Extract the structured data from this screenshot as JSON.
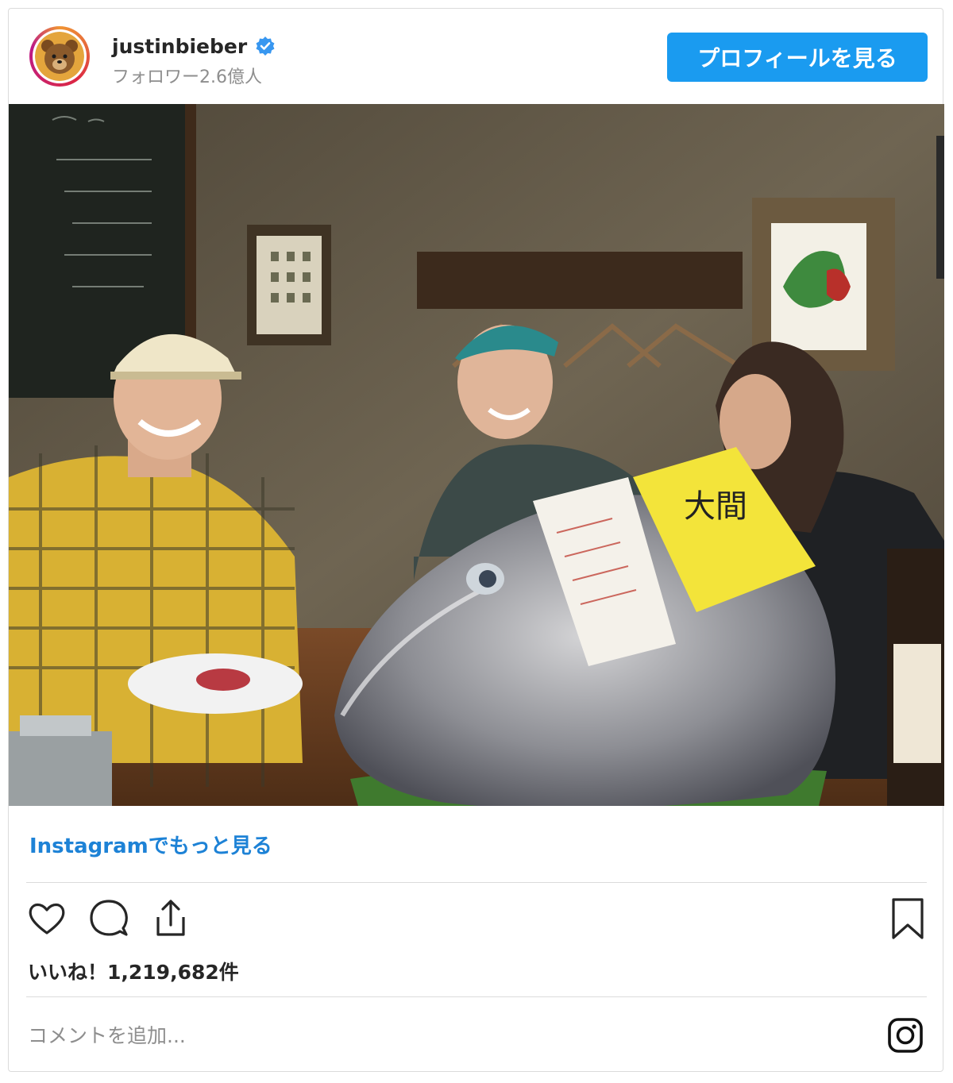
{
  "header": {
    "username": "justinbieber",
    "followers": "フォロワー2.6億人",
    "profile_button": "プロフィールを見る"
  },
  "post": {
    "image_alt": "Instagram post photo",
    "tuna_label_text": "大間",
    "view_more_link": "Instagramでもっと見る",
    "likes": "いいね！1,219,682件",
    "comment_placeholder": "コメントを追加..."
  },
  "icons": {
    "like": "heart-icon",
    "comment": "comment-icon",
    "share": "share-icon",
    "save": "bookmark-icon",
    "instagram": "instagram-logo-icon",
    "verified": "verified-badge-icon"
  },
  "colors": {
    "accent": "#1a9bf0",
    "link": "#1d82d6",
    "muted": "#8e8e8e",
    "border": "#dbdbdb"
  }
}
